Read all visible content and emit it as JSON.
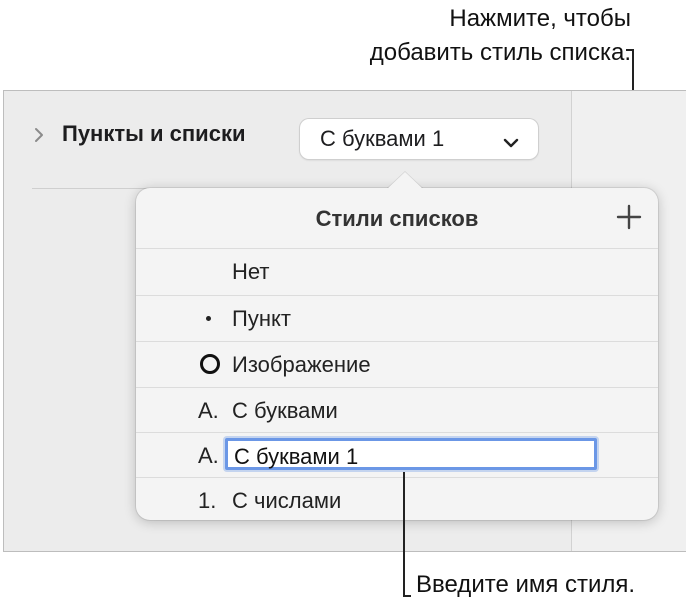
{
  "callouts": {
    "add_line1": "Нажмите, чтобы",
    "add_line2": "добавить стиль списка.",
    "name_hint": "Введите имя стиля."
  },
  "inspector": {
    "section_label": "Пункты и списки",
    "popup_value": "С буквами 1"
  },
  "popover": {
    "title": "Стили списков",
    "rows": [
      {
        "marker": "",
        "label": "Нет"
      },
      {
        "marker": "bullet",
        "label": "Пункт"
      },
      {
        "marker": "circle-image",
        "label": "Изображение"
      },
      {
        "marker": "A.",
        "label": "С буквами"
      },
      {
        "marker": "A.",
        "label": "С буквами 1",
        "editing": true
      },
      {
        "marker": "1.",
        "label": "С числами"
      }
    ]
  },
  "icons": {
    "disclosure": "chevron-right-icon",
    "popup": "chevron-down-icon",
    "add": "plus-icon"
  }
}
